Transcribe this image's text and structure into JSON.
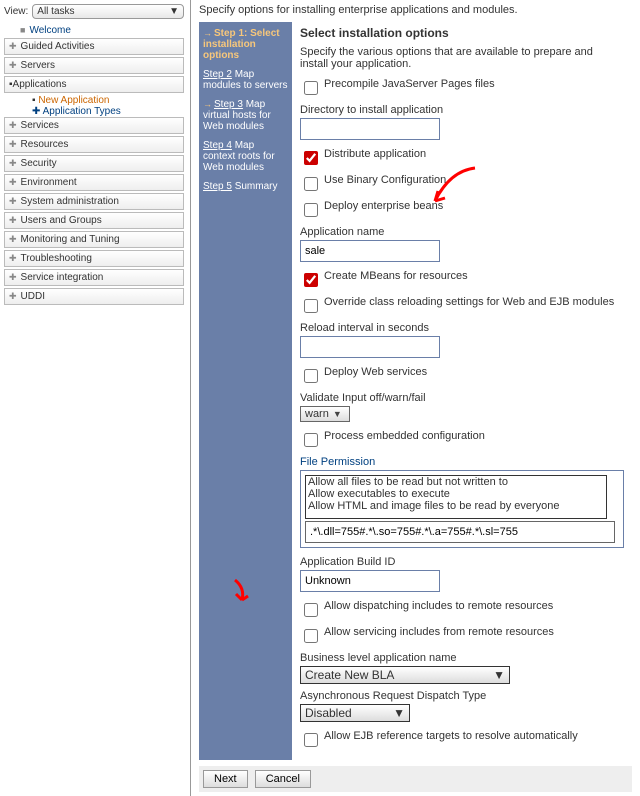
{
  "left": {
    "view_label": "View:",
    "view_value": "All tasks",
    "items": [
      "Welcome",
      "Guided Activities",
      "Servers",
      "Applications",
      "Services",
      "Resources",
      "Security",
      "Environment",
      "System administration",
      "Users and Groups",
      "Monitoring and Tuning",
      "Troubleshooting",
      "Service integration",
      "UDDI"
    ],
    "app_sub": "New Application",
    "app_sub2": "Application Types"
  },
  "desc": "Specify options for installing enterprise applications and modules.",
  "steps": {
    "s1": "Step 1: Select installation options",
    "s2": "Step 2",
    "s2b": "Map modules to servers",
    "s3": "Step 3",
    "s3b": "Map virtual hosts for Web modules",
    "s4": "Step 4",
    "s4b": "Map context roots for Web modules",
    "s5": "Step 5",
    "s5b": "Summary"
  },
  "form": {
    "title": "Select installation options",
    "intro": "Specify the various options that are available to prepare and install your application.",
    "precompile": "Precompile JavaServer Pages files",
    "dir_label": "Directory to install application",
    "dir_value": "",
    "distribute": "Distribute application",
    "binary": "Use Binary Configuration",
    "deploy_ejb": "Deploy enterprise beans",
    "appname_label": "Application name",
    "appname_value": "sale",
    "mbeans": "Create MBeans for resources",
    "override": "Override class reloading settings for Web and EJB modules",
    "reload_label": "Reload interval in seconds",
    "reload_value": "",
    "deploy_ws": "Deploy Web services",
    "validate_label": "Validate Input off/warn/fail",
    "validate_value": "warn",
    "embedded": "Process embedded configuration",
    "fp_label": "File Permission",
    "fp_options": [
      "Allow all files to be read but not written to",
      "Allow executables to execute",
      "Allow HTML and image files to be read by everyone"
    ],
    "fp_pattern": ".*\\.dll=755#.*\\.so=755#.*\\.a=755#.*\\.sl=755",
    "build_label": "Application Build ID",
    "build_value": "Unknown",
    "dispatching": "Allow dispatching includes to remote resources",
    "servicing": "Allow servicing includes from remote resources",
    "bla_label": "Business level application name",
    "bla_value": "Create New BLA",
    "async_label": "Asynchronous Request Dispatch Type",
    "async_value": "Disabled",
    "ejb_ref": "Allow EJB reference targets to resolve automatically"
  },
  "buttons": {
    "next": "Next",
    "cancel": "Cancel"
  }
}
